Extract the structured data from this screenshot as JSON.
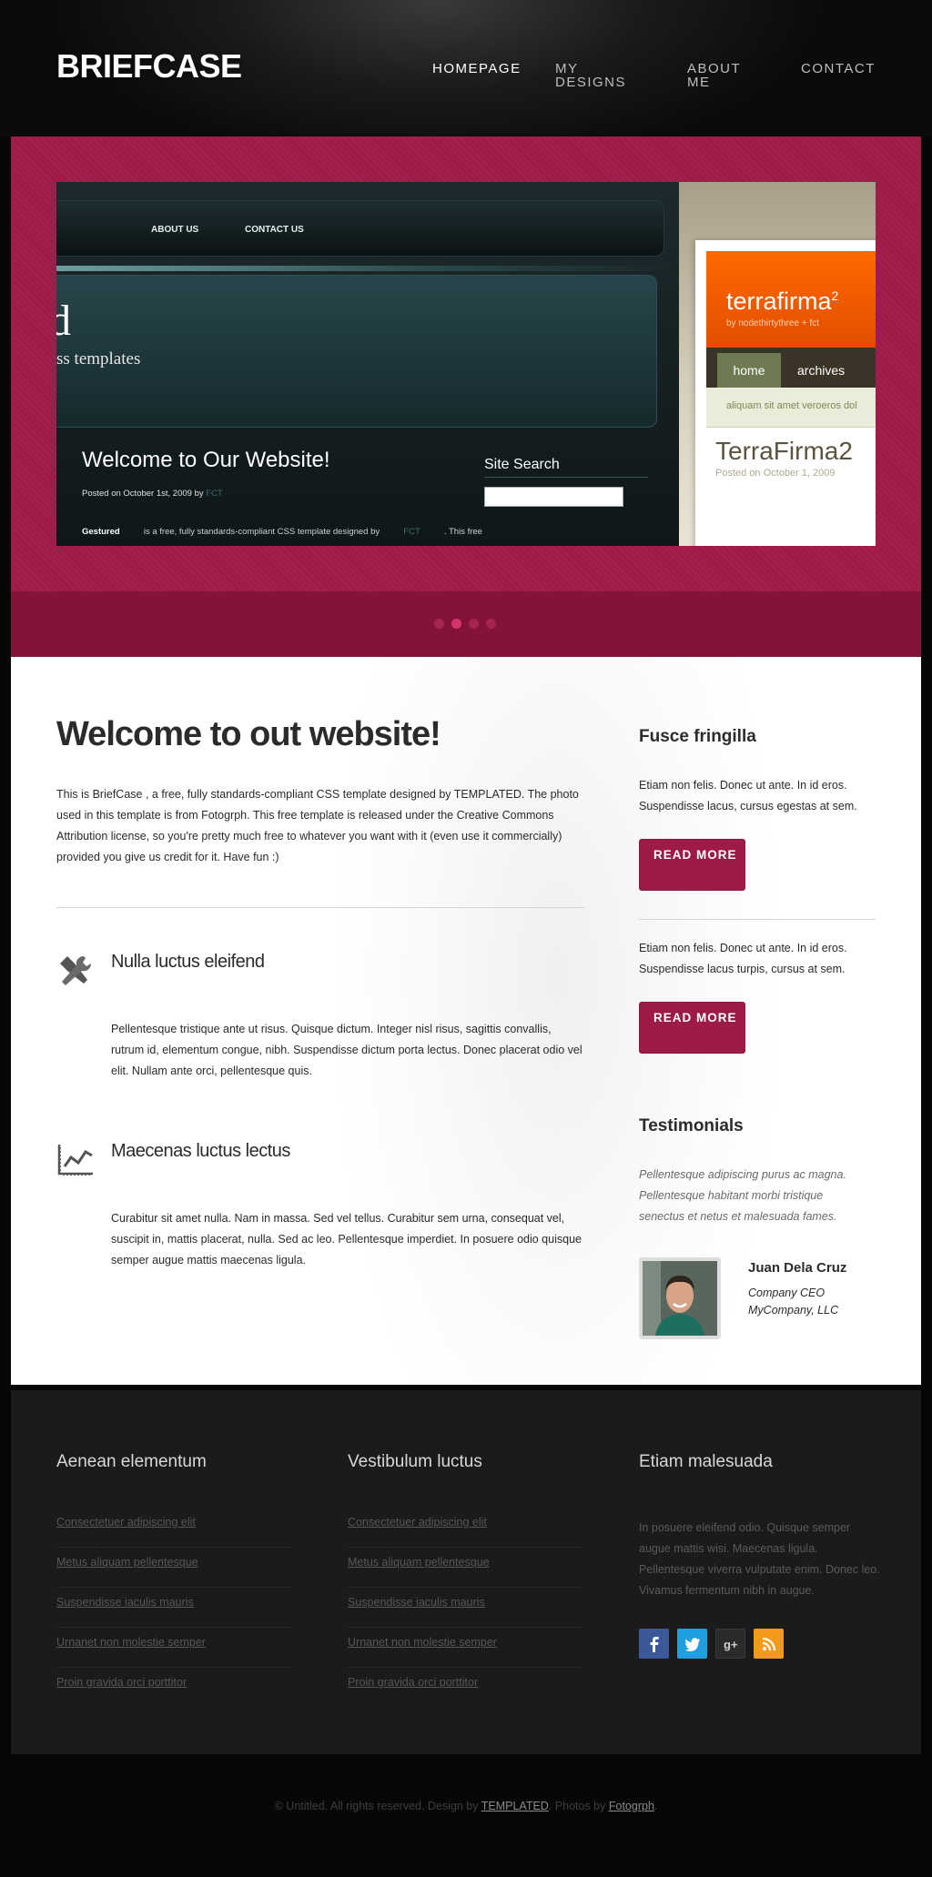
{
  "header": {
    "logo": "BRIEFCASE",
    "nav": [
      {
        "label": "HOMEPAGE",
        "active": true
      },
      {
        "label": "MY DESIGNS",
        "active": false
      },
      {
        "label": "ABOUT ME",
        "active": false
      },
      {
        "label": "CONTACT",
        "active": false
      }
    ]
  },
  "slider": {
    "slide_nav": [
      "ABOUT US",
      "CONTACT US"
    ],
    "hero_big": "d",
    "hero_sub": "ss templates",
    "welcome": "Welcome to Our Website!",
    "posted_prefix": "Posted on October 1st, 2009 by",
    "posted_by": "FCT",
    "body_bold": "Gestured",
    "body_text": "is a free, fully standards-compliant CSS template designed by",
    "body_link": "FCT",
    "body_end": ". This free",
    "search_title": "Site Search",
    "terrafirma_title": "terrafirma",
    "terrafirma_sup": "2",
    "terrafirma_by": "by nodethirtythree + fct",
    "terrafirma_menu": [
      "home",
      "archives"
    ],
    "terrafirma_strip": "aliquam sit amet veroeros dol",
    "terrafirma2_title": "TerraFirma2",
    "terrafirma2_posted": "Posted on October 1, 2009",
    "dots": 4,
    "active_dot": 1
  },
  "main": {
    "title": "Welcome to out website!",
    "intro": "This is BriefCase , a free, fully standards-compliant CSS template designed by TEMPLATED. The photo used in this template is from Fotogrph. This free template is released under the Creative Commons Attribution license, so you're pretty much free to whatever you want with it (even use it commercially) provided you give us credit for it. Have fun :)",
    "features": [
      {
        "icon": "tools-icon",
        "title": "Nulla luctus eleifend",
        "text": "Pellentesque tristique ante ut risus. Quisque dictum. Integer nisl risus, sagittis convallis, rutrum id, elementum congue, nibh. Suspendisse dictum porta lectus. Donec placerat odio vel elit. Nullam ante orci, pellentesque quis."
      },
      {
        "icon": "chart-icon",
        "title": "Maecenas luctus lectus",
        "text": "Curabitur sit amet nulla. Nam in massa. Sed vel tellus. Curabitur sem urna, consequat vel, suscipit in, mattis placerat, nulla. Sed ac leo. Pellentesque imperdiet. In posuere odio quisque semper augue mattis maecenas ligula."
      }
    ]
  },
  "sidebar": {
    "title": "Fusce fringilla",
    "blocks": [
      {
        "text": "Etiam non felis. Donec ut ante. In id eros. Suspendisse lacus, cursus egestas at sem.",
        "button": "READ MORE"
      },
      {
        "text": "Etiam non felis. Donec ut ante. In id eros. Suspendisse lacus turpis, cursus at sem.",
        "button": "READ MORE"
      }
    ],
    "testimonials_title": "Testimonials",
    "quote": "Pellentesque adipiscing purus ac magna. Pellentesque habitant morbi tristique senectus et netus et malesuada fames.",
    "name": "Juan Dela Cruz",
    "role": "Company CEO",
    "company": "MyCompany, LLC"
  },
  "footer": {
    "col1": {
      "title": "Aenean elementum",
      "links": [
        "Consectetuer adipiscing elit",
        "Metus aliquam pellentesque",
        "Suspendisse iaculis mauris",
        "Urnanet non molestie semper",
        "Proin gravida orci porttitor"
      ]
    },
    "col2": {
      "title": "Vestibulum luctus",
      "links": [
        "Consectetuer adipiscing elit",
        "Metus aliquam pellentesque",
        "Suspendisse iaculis mauris",
        "Urnanet non molestie semper",
        "Proin gravida orci porttitor"
      ]
    },
    "col3": {
      "title": "Etiam malesuada",
      "text": "In posuere eleifend odio. Quisque semper augue mattis wisi. Maecenas ligula. Pellentesque viverra vulputate enim. Donec leo. Vivamus fermentum nibh in augue."
    },
    "social": [
      "facebook-icon",
      "twitter-icon",
      "google-plus-icon",
      "rss-icon"
    ],
    "social_colors": [
      "#3b5998",
      "#1d9fe0",
      "#2b2b2b",
      "#f39a1c"
    ]
  },
  "copyright": {
    "prefix": "© Untitled. All rights reserved. Design by",
    "design_link": "TEMPLATED",
    "middle": ". Photos by",
    "photo_link": "Fotogrph",
    "suffix": "."
  },
  "colors": {
    "accent": "#9e1a48",
    "accent_dark": "#84133a",
    "footer_bg": "#1b1b1b"
  }
}
